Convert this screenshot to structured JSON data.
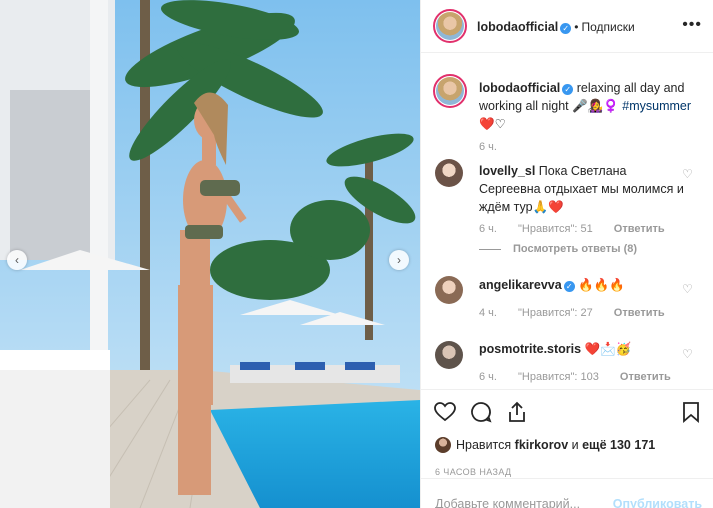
{
  "header": {
    "username": "lobodaofficial",
    "separator": "•",
    "follow_status": "Подписки",
    "more_icon": "more-horizontal-icon"
  },
  "post": {
    "username": "lobodaofficial",
    "caption": "relaxing all day and working all night 🎤👩‍🎤♀️",
    "hashtag": "#mysummer",
    "caption_emoji": "❤️♡",
    "time": "6 ч."
  },
  "comments": [
    {
      "username": "lovelly_sl",
      "text": "Пока Светлана Сергеевна отдыхает мы молимся и ждём тур🙏❤️",
      "time": "6 ч.",
      "likes": "\"Нравится\": 51",
      "reply": "Ответить",
      "view_replies": "Посмотреть ответы (8)"
    },
    {
      "username": "angelikarevva",
      "text": "🔥🔥🔥",
      "time": "4 ч.",
      "likes": "\"Нравится\": 27",
      "reply": "Ответить"
    },
    {
      "username": "posmotrite.storis",
      "text": "❤️📩🥳",
      "time": "6 ч.",
      "likes": "\"Нравится\": 103",
      "reply": "Ответить"
    }
  ],
  "actions": {
    "icons": [
      "heart-icon",
      "comment-icon",
      "share-icon",
      "bookmark-icon"
    ],
    "liked_prefix": "Нравится",
    "liked_user": "fkirkorov",
    "liked_and": "и",
    "liked_count": "ещё 130 171",
    "time_ago": "6 ЧАСОВ НАЗАД"
  },
  "comment_input": {
    "placeholder": "Добавьте комментарий...",
    "publish": "Опубликовать"
  },
  "carousel": {
    "prev_icon": "chevron-left-icon",
    "next_icon": "chevron-right-icon"
  },
  "colors": {
    "link": "#003569",
    "verified": "#3897f0",
    "muted": "#999999",
    "publish_disabled": "#b2dffc"
  }
}
